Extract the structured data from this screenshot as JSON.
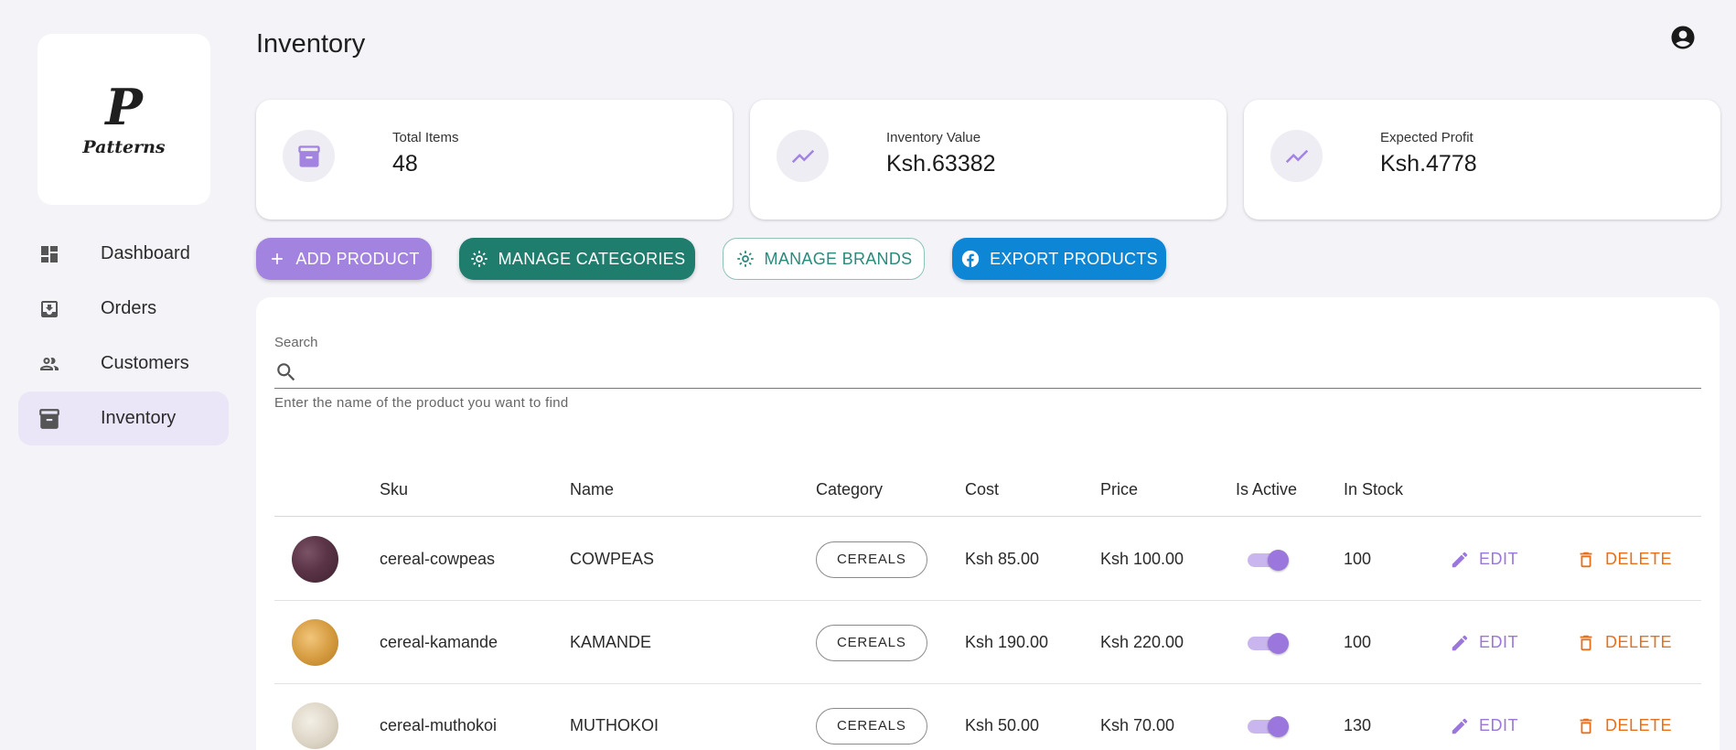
{
  "app": {
    "logo_mark": "P",
    "logo_text": "Patterns"
  },
  "sidebar": {
    "items": [
      {
        "label": "Dashboard",
        "icon": "dashboard-icon",
        "active": false
      },
      {
        "label": "Orders",
        "icon": "orders-icon",
        "active": false
      },
      {
        "label": "Customers",
        "icon": "customers-icon",
        "active": false
      },
      {
        "label": "Inventory",
        "icon": "inventory-icon",
        "active": true
      }
    ]
  },
  "header": {
    "title": "Inventory",
    "account_icon": "account-circle-icon"
  },
  "stats": [
    {
      "label": "Total Items",
      "value": "48",
      "icon": "archive-icon"
    },
    {
      "label": "Inventory Value",
      "value": "Ksh.63382",
      "icon": "trending-up-icon"
    },
    {
      "label": "Expected Profit",
      "value": "Ksh.4778",
      "icon": "trending-up-icon"
    }
  ],
  "toolbar": {
    "add_label": "ADD PRODUCT",
    "categories_label": "MANAGE CATEGORIES",
    "brands_label": "MANAGE BRANDS",
    "export_label": "EXPORT PRODUCTS"
  },
  "search": {
    "label": "Search",
    "value": "",
    "placeholder": "",
    "helper": "Enter the name of the product you want to find"
  },
  "table": {
    "columns": [
      "",
      "Sku",
      "Name",
      "Category",
      "Cost",
      "Price",
      "Is Active",
      "In Stock"
    ],
    "edit_label": "EDIT",
    "delete_label": "DELETE",
    "rows": [
      {
        "sku": "cereal-cowpeas",
        "name": "COWPEAS",
        "category": "CEREALS",
        "cost": "Ksh 85.00",
        "price": "Ksh 100.00",
        "is_active": true,
        "in_stock": "100"
      },
      {
        "sku": "cereal-kamande",
        "name": "KAMANDE",
        "category": "CEREALS",
        "cost": "Ksh 190.00",
        "price": "Ksh 220.00",
        "is_active": true,
        "in_stock": "100"
      },
      {
        "sku": "cereal-muthokoi",
        "name": "MUTHOKOI",
        "category": "CEREALS",
        "cost": "Ksh 50.00",
        "price": "Ksh 70.00",
        "is_active": true,
        "in_stock": "130"
      }
    ]
  },
  "colors": {
    "primary": "#a383e0",
    "teal": "#1f7d6e",
    "blue": "#0d86d6",
    "delete": "#e8701d",
    "active_nav_bg": "#ebe6f7"
  }
}
